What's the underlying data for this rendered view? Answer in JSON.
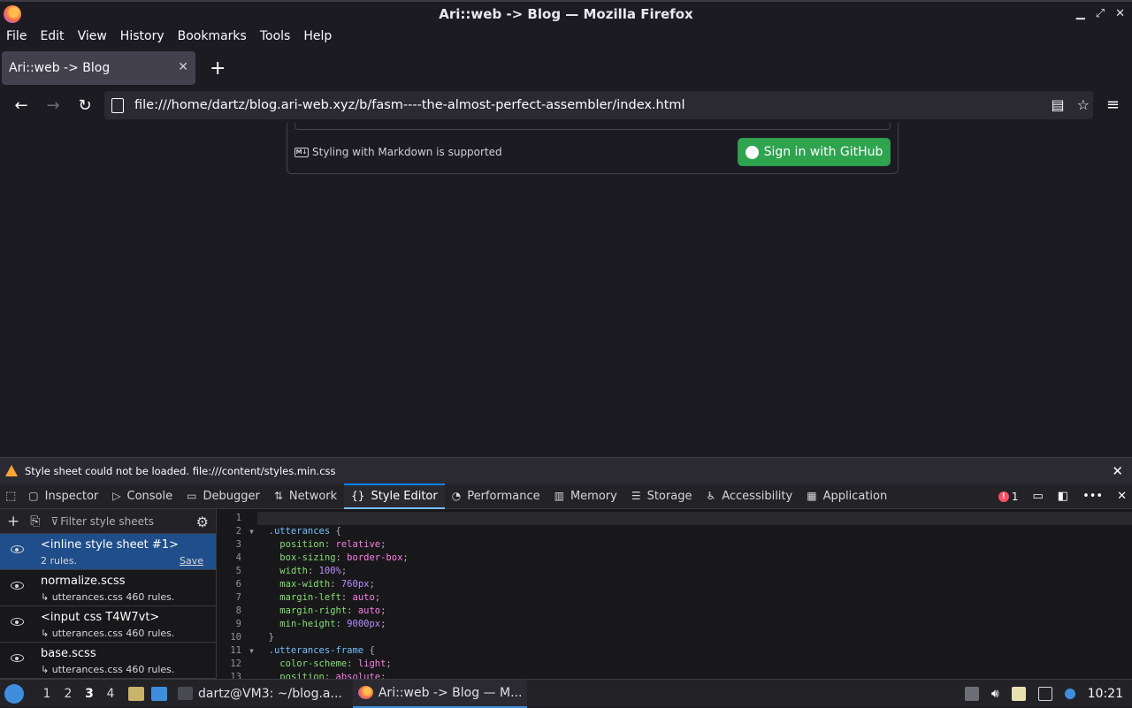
{
  "window": {
    "title": "Ari::web -> Blog — Mozilla Firefox"
  },
  "menu": [
    "File",
    "Edit",
    "View",
    "History",
    "Bookmarks",
    "Tools",
    "Help"
  ],
  "tab": {
    "label": "Ari::web -> Blog",
    "close": "✕"
  },
  "url": {
    "value": "file:///home/dartz/blog.ari-web.xyz/b/fasm----the-almost-perfect-assembler/index.html"
  },
  "page": {
    "markdown_note": "Styling with Markdown is supported",
    "md_icon": "M↓",
    "github_button": "Sign in with GitHub"
  },
  "notice": {
    "text": "Style sheet could not be loaded. file:///content/styles.min.css"
  },
  "devtools": {
    "tabs": [
      {
        "label": "Inspector",
        "icon": "inspector-icon"
      },
      {
        "label": "Console",
        "icon": "console-icon"
      },
      {
        "label": "Debugger",
        "icon": "debugger-icon"
      },
      {
        "label": "Network",
        "icon": "network-icon"
      },
      {
        "label": "Style Editor",
        "icon": "style-editor-icon"
      },
      {
        "label": "Performance",
        "icon": "performance-icon"
      },
      {
        "label": "Memory",
        "icon": "memory-icon"
      },
      {
        "label": "Storage",
        "icon": "storage-icon"
      },
      {
        "label": "Accessibility",
        "icon": "accessibility-icon"
      },
      {
        "label": "Application",
        "icon": "application-icon"
      }
    ],
    "error_count": "1",
    "filter_placeholder": "Filter style sheets",
    "sheets": [
      {
        "name": "<inline style sheet #1>",
        "rules": "2 rules.",
        "save": "Save",
        "selected": true
      },
      {
        "name": "normalize.scss",
        "rules": "↳ utterances.css 460 rules."
      },
      {
        "name": "<input css T4W7vt>",
        "rules": "↳ utterances.css 460 rules."
      },
      {
        "name": "base.scss",
        "rules": "↳ utterances.css 460 rules."
      }
    ],
    "code_lines": [
      {
        "n": "1",
        "text": ""
      },
      {
        "n": "2",
        "text": "  .utterances {",
        "fold": true
      },
      {
        "n": "3",
        "text": "    position: relative;"
      },
      {
        "n": "4",
        "text": "    box-sizing: border-box;"
      },
      {
        "n": "5",
        "text": "    width: 100%;"
      },
      {
        "n": "6",
        "text": "    max-width: 760px;"
      },
      {
        "n": "7",
        "text": "    margin-left: auto;"
      },
      {
        "n": "8",
        "text": "    margin-right: auto;"
      },
      {
        "n": "9",
        "text": "    min-height: 9000px;"
      },
      {
        "n": "10",
        "text": "  }"
      },
      {
        "n": "11",
        "text": "  .utterances-frame {",
        "fold": true
      },
      {
        "n": "12",
        "text": "    color-scheme: light;"
      },
      {
        "n": "13",
        "text": "    position: absolute;"
      }
    ]
  },
  "taskbar": {
    "workspaces": [
      "1",
      "2",
      "3",
      "4"
    ],
    "active_workspace": "3",
    "tasks": [
      {
        "label": "dartz@VM3: ~/blog.a...",
        "icon": "terminal-icon"
      },
      {
        "label": "Ari::web -> Blog — M...",
        "icon": "firefox-icon",
        "active": true
      }
    ],
    "clock": "10:21"
  },
  "colors": {
    "accent": "#0a84ff",
    "github_green": "#2ea44f",
    "warning": "#ffa436",
    "error": "#ff4f5e"
  }
}
